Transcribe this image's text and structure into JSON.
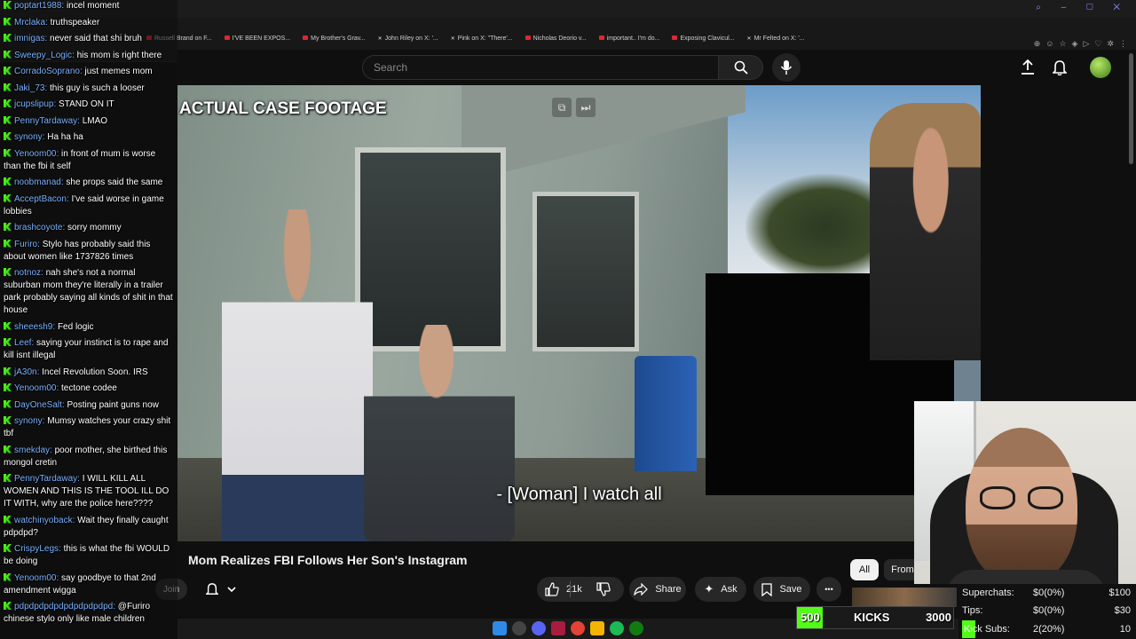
{
  "browser": {
    "bookmarks": [
      "Russell Brand on F...",
      "I'VE BEEN EXPOS...",
      "My Brother's Grav...",
      "John Riley on X: '...",
      "Pink on X: \"There'...",
      "Nicholas Deorio v...",
      "important.. I'm do...",
      "Exposing Clavicul...",
      "Mr Felted on X: '..."
    ]
  },
  "header": {
    "search_placeholder": "Search"
  },
  "video": {
    "overlay_title": "ACTUAL CASE FOOTAGE",
    "caption": "- [Woman] I watch all",
    "title": "Mom Realizes FBI Follows Her Son's Instagram"
  },
  "actions": {
    "join": "Join",
    "likes": "21k",
    "share": "Share",
    "ask": "Ask",
    "save": "Save",
    "more": "•••"
  },
  "chips": {
    "all": "All",
    "from": "From"
  },
  "chat": [
    {
      "user": "poptart1988",
      "text": "incel moment"
    },
    {
      "user": "Mrclaka",
      "text": "truthspeaker"
    },
    {
      "user": "imnigas",
      "text": "never said that shi bruh"
    },
    {
      "user": "Sweepy_Logic",
      "text": "his mom is right there"
    },
    {
      "user": "CorradoSoprano",
      "text": "just memes mom"
    },
    {
      "user": "Jaki_73",
      "text": "this guy is such a looser"
    },
    {
      "user": "jcupslipup",
      "text": "STAND ON IT"
    },
    {
      "user": "PennyTardaway",
      "text": "LMAO"
    },
    {
      "user": "synony",
      "text": "Ha ha ha"
    },
    {
      "user": "Yenoom00",
      "text": "in front of mum is worse than the fbi it self"
    },
    {
      "user": "noobmanad",
      "text": "she props said the same"
    },
    {
      "user": "AcceptBacon",
      "text": "I've said worse in game lobbies"
    },
    {
      "user": "brashcoyote",
      "text": "sorry mommy"
    },
    {
      "user": "Furiro",
      "text": "Stylo has probably said this about women like 1737826 times"
    },
    {
      "user": "notnoz",
      "text": "nah she's not a normal suburban mom they're literally in a trailer park probably saying all kinds of shit in that house"
    },
    {
      "user": "sheeesh9",
      "text": "Fed logic"
    },
    {
      "user": "Leef",
      "text": "saying your instinct is to rape and kill isnt illegal"
    },
    {
      "user": "jA30n",
      "text": "Incel Revolution Soon. IRS"
    },
    {
      "user": "Yenoom00",
      "text": "tectone codee"
    },
    {
      "user": "DayOneSalt",
      "text": "Posting paint guns now"
    },
    {
      "user": "synony",
      "text": "Mumsy watches your crazy shit tbf"
    },
    {
      "user": "smekday",
      "text": "poor mother, she birthed this mongol cretin"
    },
    {
      "user": "PennyTardaway",
      "text": "I WILL KILL ALL WOMEN AND THIS IS THE TOOL ILL DO IT WITH, why are the police here????"
    },
    {
      "user": "watchinyoback",
      "text": "Wait they finally caught pdpdpd?"
    },
    {
      "user": "CrispyLegs",
      "text": "this is what the fbi WOULD be doing"
    },
    {
      "user": "Yenoom00",
      "text": "say goodbye to that 2nd amendment wigga"
    },
    {
      "user": "pdpdpdpdpdpdpdpdpdpd",
      "text": "@Furiro chinese stylo only like male children"
    }
  ],
  "stats": {
    "superchats_label": "Superchats:",
    "superchats_value": "$0(0%)",
    "superchats_goal": "$100",
    "tips_label": "Tips:",
    "tips_value": "$0(0%)",
    "tips_goal": "$30",
    "subs_label": "Kick Subs:",
    "subs_value": "2(20%)",
    "subs_goal": "10",
    "subs_progress": 0.2
  },
  "kicks": {
    "current": "500",
    "label": "KICKS",
    "goal": "3000",
    "progress": 0.1667
  },
  "colors": {
    "kick_green": "#53fc18",
    "chat_user": "#7ab2ff"
  }
}
